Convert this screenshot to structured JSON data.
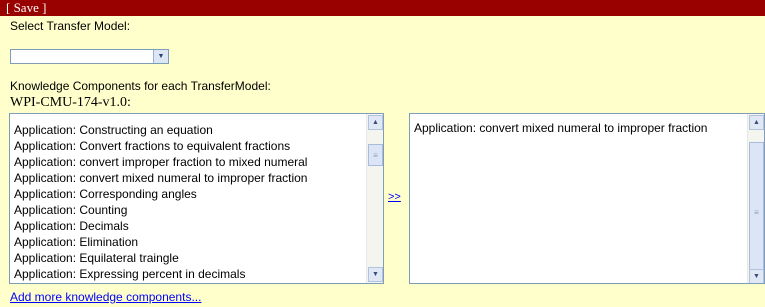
{
  "toolbar": {
    "save_label": "[ Save ]"
  },
  "transfer_model": {
    "label": "Select Transfer Model:",
    "selected_value": ""
  },
  "kc_section_label": "Knowledge Components for each TransferModel:",
  "model_name": "WPI-CMU-174-v1.0:",
  "available_components": [
    "Application: Constructing an equation",
    "Application: Convert fractions to equivalent fractions",
    "Application: convert improper fraction to mixed numeral",
    "Application: convert mixed numeral to improper fraction",
    "Application: Corresponding angles",
    "Application: Counting",
    "Application: Decimals",
    "Application: Elimination",
    "Application: Equilateral traingle",
    "Application: Expressing percent in decimals"
  ],
  "selected_components": [
    "Application: convert mixed numeral to improper fraction"
  ],
  "move_button_label": ">>",
  "add_more_label": "Add more knowledge components..."
}
